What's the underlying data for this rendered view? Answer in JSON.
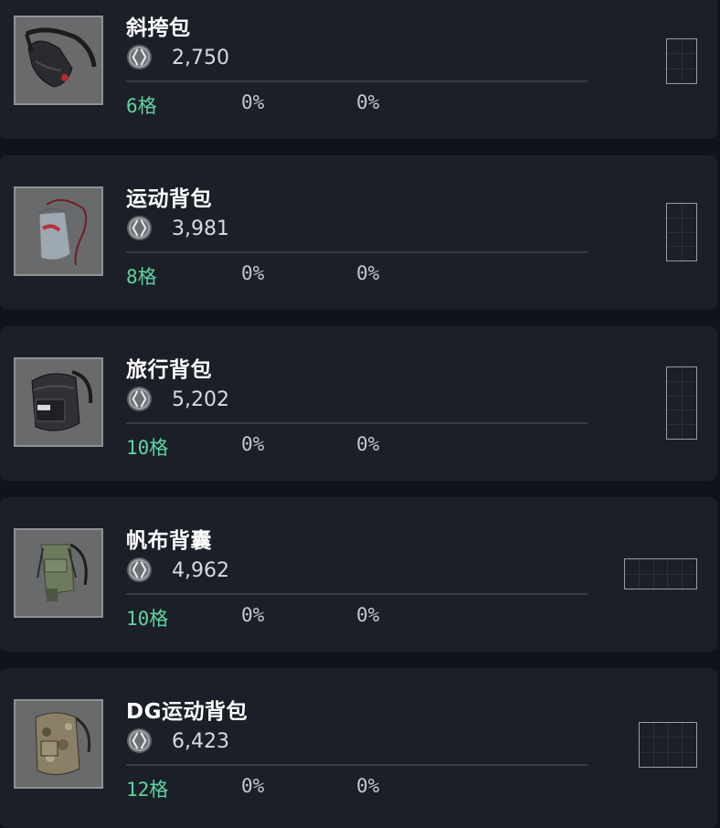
{
  "items": [
    {
      "name": "斜挎包",
      "price": "2,750",
      "slots": "6格",
      "stat1": "0%",
      "stat2": "0%",
      "grid": {
        "cols": 2,
        "rows": 3
      },
      "icon": "sling-bag-icon"
    },
    {
      "name": "运动背包",
      "price": "3,981",
      "slots": "8格",
      "stat1": "0%",
      "stat2": "0%",
      "grid": {
        "cols": 2,
        "rows": 4
      },
      "icon": "drawstring-bag-icon"
    },
    {
      "name": "旅行背包",
      "price": "5,202",
      "slots": "10格",
      "stat1": "0%",
      "stat2": "0%",
      "grid": {
        "cols": 2,
        "rows": 5
      },
      "icon": "travel-backpack-icon"
    },
    {
      "name": "帆布背囊",
      "price": "4,962",
      "slots": "10格",
      "stat1": "0%",
      "stat2": "0%",
      "grid": {
        "cols": 5,
        "rows": 2
      },
      "icon": "canvas-backpack-icon"
    },
    {
      "name": "DG运动背包",
      "price": "6,423",
      "slots": "12格",
      "stat1": "0%",
      "stat2": "0%",
      "grid": {
        "cols": 4,
        "rows": 3
      },
      "icon": "camo-backpack-icon"
    }
  ],
  "colors": {
    "background": "#10131a",
    "card": "#1b1f28",
    "slots_text": "#5fd3a2",
    "stat_text": "#c6c8cc",
    "price_text": "#d9dadd"
  },
  "currency_icon": "coin-icon"
}
